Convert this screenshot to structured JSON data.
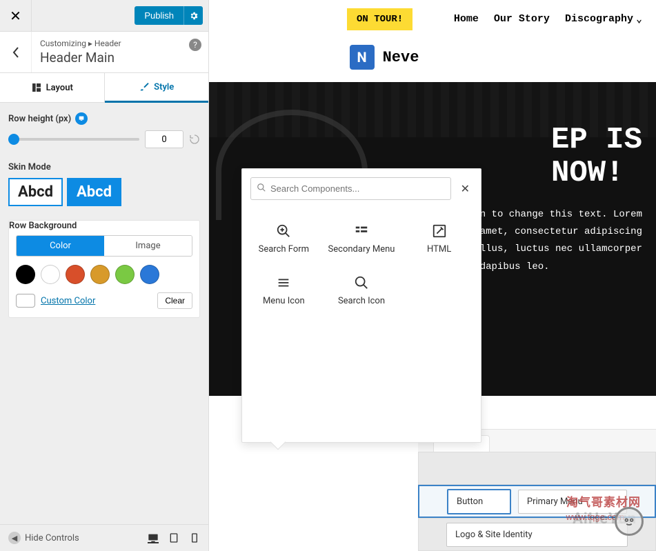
{
  "sidebar": {
    "publish": "Publish",
    "breadcrumb_prefix": "Customizing ▸ Header",
    "breadcrumb_title": "Header Main",
    "tabs": {
      "layout": "Layout",
      "style": "Style"
    },
    "row_height": {
      "label": "Row height (px)",
      "value": "0"
    },
    "skin": {
      "label": "Skin Mode",
      "light": "Abcd",
      "dark": "Abcd"
    },
    "bg": {
      "label": "Row Background",
      "color_tab": "Color",
      "image_tab": "Image",
      "custom": "Custom Color",
      "clear": "Clear"
    },
    "swatches": [
      "#000000",
      "#ffffff",
      "#d84f2a",
      "#d89a2a",
      "#7ac943",
      "#2a78d8"
    ]
  },
  "footer": {
    "hide": "Hide Controls"
  },
  "preview": {
    "on_tour": "ON TOUR!",
    "nav": {
      "home": "Home",
      "our_story": "Our Story",
      "discography": "Discography"
    },
    "site": "Neve",
    "hero_title_l1": "EP IS",
    "hero_title_l2": "NOW!",
    "hero_p1": "n to change this text. Lorem",
    "hero_p2": "amet, consectetur adipiscing",
    "hero_p3": "llus, luctus nec ullamcorper",
    "hero_p4": " dapibus leo."
  },
  "popover": {
    "placeholder": "Search Components...",
    "items": {
      "search_form": "Search Form",
      "secondary_menu": "Secondary Menu",
      "html": "HTML",
      "menu_icon": "Menu Icon",
      "search_icon": "Search Icon"
    }
  },
  "builder": {
    "button": "Button",
    "primary_menu": "Primary Menu",
    "logo": "Logo & Site Identity"
  },
  "watermark": {
    "main": "淘气哥素材网",
    "url": "www.tqge.com",
    "alt": "AiHeYun"
  }
}
